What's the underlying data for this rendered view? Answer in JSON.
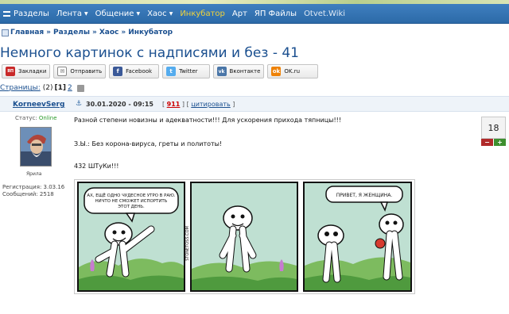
{
  "nav": {
    "items": [
      "Разделы",
      "Лента",
      "Общение",
      "Хаос",
      "Инкубатор",
      "Арт",
      "ЯП Файлы",
      "Otvet.Wiki"
    ]
  },
  "breadcrumb": [
    "Главная",
    "Разделы",
    "Хаос",
    "Инкубатор"
  ],
  "title": "Немного картинок с надписями и без - 41",
  "share": {
    "bookmarks": "Закладки",
    "send": "Отправить",
    "facebook": "Facebook",
    "twitter": "Twitter",
    "vkontakte": "Вконтакте",
    "ok": "OK.ru"
  },
  "pages": {
    "label": "Страницы:",
    "count": "(2)",
    "current": "[1]",
    "next": "2"
  },
  "post": {
    "author": "KorneevSerg",
    "date": "30.01.2020 - 09:15",
    "number": "911",
    "quote": "цитировать",
    "status_label": "Статус:",
    "status_value": "Online",
    "avatar_name": "Ярила",
    "registration": "Регистрация: 3.03.16",
    "messages": "Сообщений: 2518",
    "text1": "Разной степени новизны и адекватности!!! Для ускорения прихода тяпницы!!!",
    "text2": "З.Ы.: Без корона-вируса, греты и политоты!",
    "text3": "432 ШТуКи!!!",
    "rating": "18"
  },
  "comic": {
    "bubble1": [
      "АХ, ЕЩЁ ОДНО ЧУДЕСНОЕ УТРО В РАЮ.",
      "НИЧТО НЕ СМОЖЕТ ИСПОРТИТЬ",
      "ЭТОТ ДЕНЬ."
    ],
    "watermark": "STONETOSS.COM",
    "bubble3": "ПРИВЕТ, Я ЖЕНЩИНА."
  },
  "colors": {
    "navbar": "#2c6aa8",
    "link": "#1a4f8f",
    "incubator": "#f0d23a",
    "online": "#2a9a2a",
    "minus": "#b02a2a",
    "plus": "#3e8f2f",
    "comic_sky": "#bfe0d2",
    "comic_bush": "#4f9a3e"
  }
}
